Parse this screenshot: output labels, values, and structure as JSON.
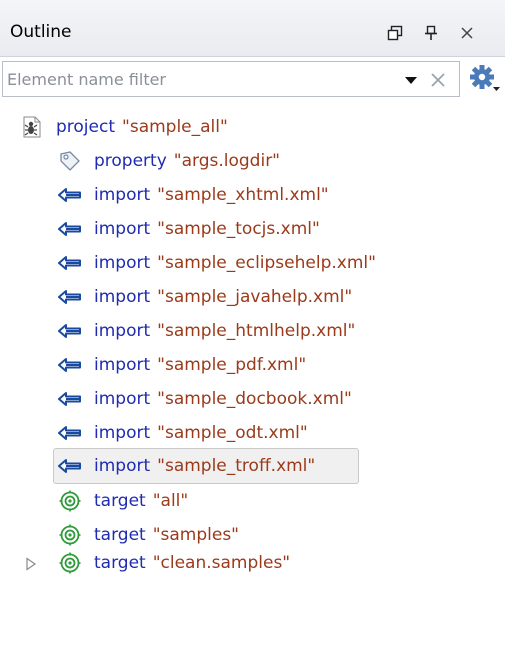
{
  "header": {
    "title": "Outline",
    "icons": [
      "restore-icon",
      "pin-icon",
      "close-icon"
    ]
  },
  "filter": {
    "placeholder": "Element name filter",
    "value": ""
  },
  "colors": {
    "keyword": "#1f2bb0",
    "value": "#9b3a1a",
    "import_arrow": "#1a4aa0",
    "target_green": "#2f9a3a"
  },
  "tree": {
    "root": {
      "keyword": "project",
      "value": "\"sample_all\"",
      "icon": "ant-project-icon"
    },
    "property": {
      "keyword": "property",
      "value": "\"args.logdir\"",
      "icon": "property-tag-icon"
    },
    "imports": [
      {
        "keyword": "import",
        "value": "\"sample_xhtml.xml\""
      },
      {
        "keyword": "import",
        "value": "\"sample_tocjs.xml\""
      },
      {
        "keyword": "import",
        "value": "\"sample_eclipsehelp.xml\""
      },
      {
        "keyword": "import",
        "value": "\"sample_javahelp.xml\""
      },
      {
        "keyword": "import",
        "value": "\"sample_htmlhelp.xml\""
      },
      {
        "keyword": "import",
        "value": "\"sample_pdf.xml\""
      },
      {
        "keyword": "import",
        "value": "\"sample_docbook.xml\""
      },
      {
        "keyword": "import",
        "value": "\"sample_odt.xml\""
      },
      {
        "keyword": "import",
        "value": "\"sample_troff.xml\""
      }
    ],
    "targets": [
      {
        "keyword": "target",
        "value": "\"all\""
      },
      {
        "keyword": "target",
        "value": "\"samples\""
      },
      {
        "keyword": "target",
        "value": "\"clean.samples\""
      }
    ]
  }
}
